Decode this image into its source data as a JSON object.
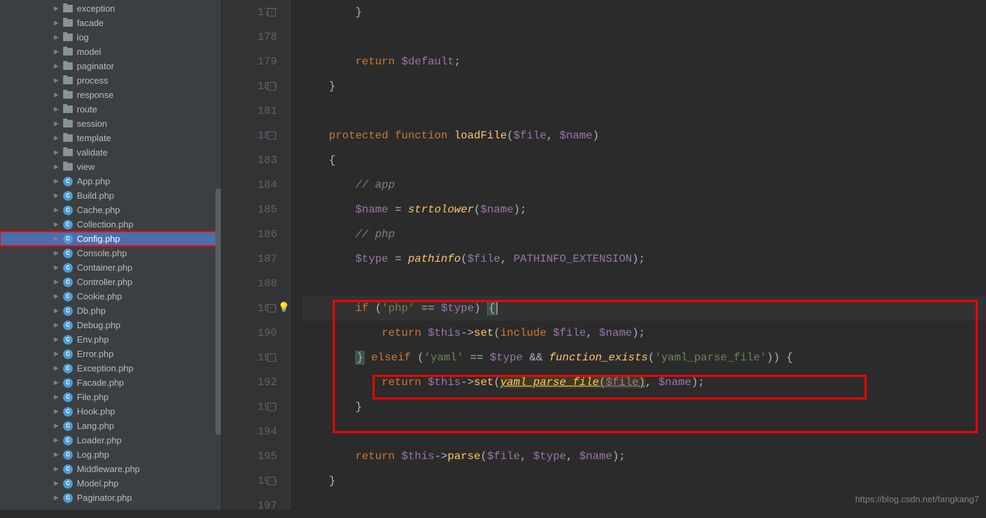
{
  "sidebar": {
    "items": [
      {
        "type": "folder",
        "label": "exception"
      },
      {
        "type": "folder",
        "label": "facade"
      },
      {
        "type": "folder",
        "label": "log"
      },
      {
        "type": "folder",
        "label": "model"
      },
      {
        "type": "folder",
        "label": "paginator"
      },
      {
        "type": "folder",
        "label": "process"
      },
      {
        "type": "folder",
        "label": "response"
      },
      {
        "type": "folder",
        "label": "route"
      },
      {
        "type": "folder",
        "label": "session"
      },
      {
        "type": "folder",
        "label": "template"
      },
      {
        "type": "folder",
        "label": "validate"
      },
      {
        "type": "folder",
        "label": "view"
      },
      {
        "type": "php",
        "label": "App.php"
      },
      {
        "type": "php",
        "label": "Build.php"
      },
      {
        "type": "php",
        "label": "Cache.php"
      },
      {
        "type": "php",
        "label": "Collection.php"
      },
      {
        "type": "php",
        "label": "Config.php",
        "selected": true,
        "boxed": true
      },
      {
        "type": "php",
        "label": "Console.php"
      },
      {
        "type": "php",
        "label": "Container.php"
      },
      {
        "type": "php",
        "label": "Controller.php"
      },
      {
        "type": "php",
        "label": "Cookie.php"
      },
      {
        "type": "php",
        "label": "Db.php"
      },
      {
        "type": "php",
        "label": "Debug.php"
      },
      {
        "type": "php",
        "label": "Env.php"
      },
      {
        "type": "php",
        "label": "Error.php"
      },
      {
        "type": "php",
        "label": "Exception.php"
      },
      {
        "type": "php",
        "label": "Facade.php"
      },
      {
        "type": "php",
        "label": "File.php"
      },
      {
        "type": "php",
        "label": "Hook.php"
      },
      {
        "type": "php",
        "label": "Lang.php"
      },
      {
        "type": "php",
        "label": "Loader.php"
      },
      {
        "type": "php",
        "label": "Log.php"
      },
      {
        "type": "php",
        "label": "Middleware.php"
      },
      {
        "type": "php",
        "label": "Model.php"
      },
      {
        "type": "php",
        "label": "Paginator.php"
      }
    ]
  },
  "editor": {
    "line_start": 177,
    "current_line": 189,
    "tokens": {
      "brace_close": "}",
      "brace_open": "{",
      "return": "return",
      "default_var": "$default",
      "semi": ";",
      "protected": "protected",
      "function": "function",
      "loadFile": "loadFile",
      "file_var": "$file",
      "name_var": "$name",
      "type_var": "$type",
      "this_var": "$this",
      "comma": ",",
      "paren_o": "(",
      "paren_c": ")",
      "cmt_app": "// app",
      "cmt_php": "// php",
      "eq": "=",
      "strtolower": "strtolower",
      "pathinfo": "pathinfo",
      "PATHINFO_EXTENSION": "PATHINFO_EXTENSION",
      "if": "if",
      "elseif": "elseif",
      "str_php": "'php'",
      "str_yaml": "'yaml'",
      "str_yamlfn": "'yaml_parse_file'",
      "eqeq": "==",
      "ampamp": "&&",
      "arrow": "->",
      "set": "set",
      "parse": "parse",
      "include": "include",
      "function_exists": "function_exists",
      "yaml_parse_file": "yaml_parse_file"
    }
  },
  "watermark": "https://blog.csdn.net/fangkang7"
}
